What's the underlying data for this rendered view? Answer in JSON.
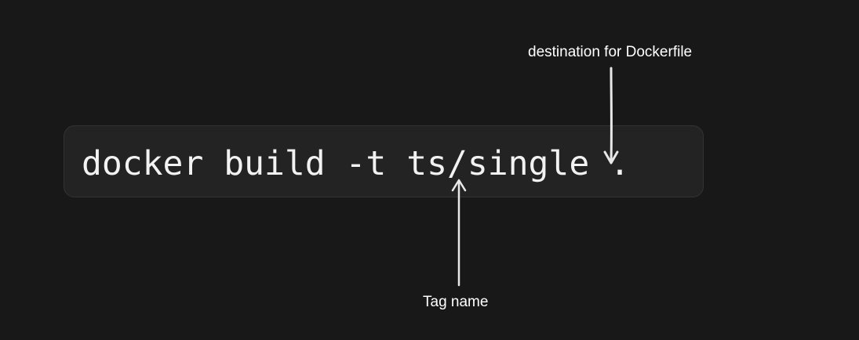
{
  "command": {
    "text": "docker build -t ts/single ."
  },
  "annotations": {
    "destination_label": "destination for Dockerfile",
    "tag_label": "Tag name"
  },
  "colors": {
    "background": "#181818",
    "box": "#232323",
    "text": "#f2f2f2",
    "arrow": "#e8e8e8"
  }
}
